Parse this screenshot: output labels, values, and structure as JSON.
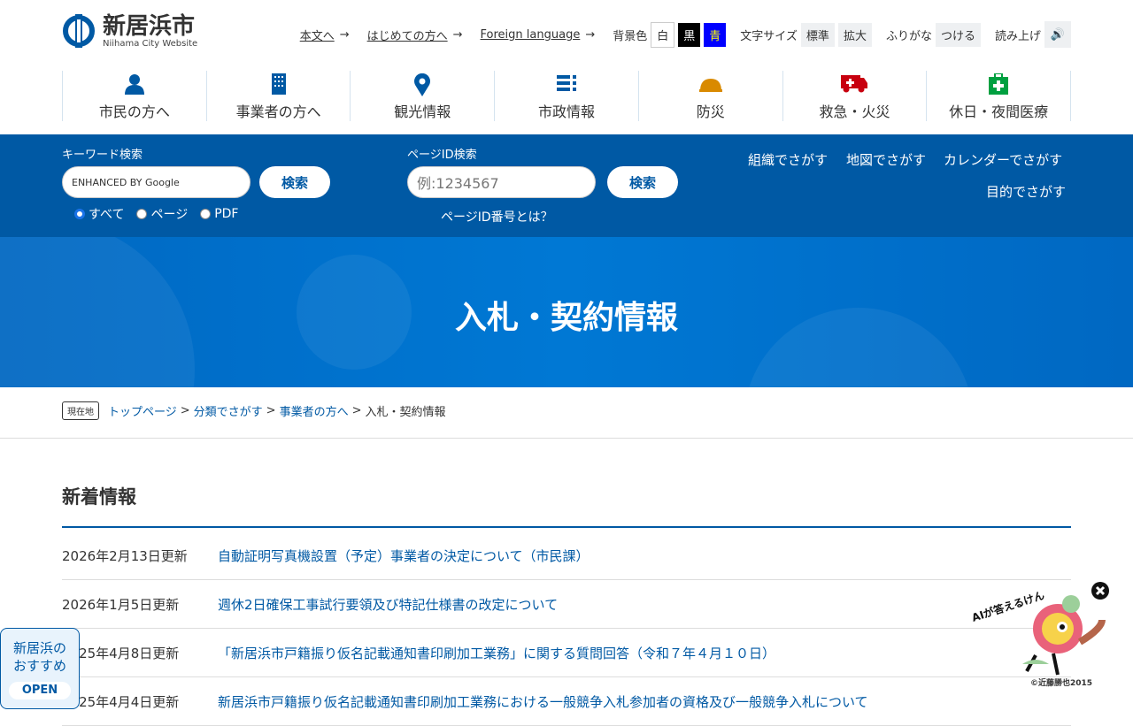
{
  "header": {
    "logo_title": "新居浜市",
    "logo_sub": "Niihama City Website",
    "links": [
      "本文へ",
      "はじめての方へ",
      "Foreign language"
    ],
    "bg_label": "背景色",
    "bg_options": [
      "白",
      "黒",
      "青"
    ],
    "size_label": "文字サイズ",
    "size_options": [
      "標準",
      "拡大"
    ],
    "furigana_label": "ふりがな",
    "furigana_btn": "つける",
    "read_label": "読み上げ"
  },
  "nav": [
    {
      "label": "市民の方へ",
      "icon": "person-icon"
    },
    {
      "label": "事業者の方へ",
      "icon": "building-icon"
    },
    {
      "label": "観光情報",
      "icon": "map-pin-icon"
    },
    {
      "label": "市政情報",
      "icon": "list-icon"
    },
    {
      "label": "防災",
      "icon": "helmet-icon"
    },
    {
      "label": "救急・火災",
      "icon": "ambulance-icon"
    },
    {
      "label": "休日・夜間医療",
      "icon": "first-aid-icon"
    }
  ],
  "search": {
    "keyword_label": "キーワード検索",
    "google_placeholder": "ENHANCED BY Google",
    "search_btn": "検索",
    "radios": [
      "すべて",
      "ページ",
      "PDF"
    ],
    "pageid_label": "ページID検索",
    "pageid_placeholder": "例:1234567",
    "pageid_btn": "検索",
    "pageid_help": "ページID番号とは？",
    "links": [
      "組織でさがす",
      "地図でさがす",
      "カレンダーでさがす",
      "目的でさがす"
    ]
  },
  "hero": {
    "title": "入札・契約情報"
  },
  "breadcrumb": {
    "here": "現在地",
    "items": [
      "トップページ",
      "分類でさがす",
      "事業者の方へ"
    ],
    "current": "入札・契約情報"
  },
  "news": {
    "title": "新着情報",
    "items": [
      {
        "date": "2026年2月13日更新",
        "title": "自動証明写真機設置（予定）事業者の決定について（市民課）"
      },
      {
        "date": "2026年1月5日更新",
        "title": "週休2日確保工事試行要領及び特記仕様書の改定について"
      },
      {
        "date": "2025年4月8日更新",
        "title": "「新居浜市戸籍振り仮名記載通知書印刷加工業務」に関する質問回答（令和７年４月１０日）"
      },
      {
        "date": "2025年4月4日更新",
        "title": "新居浜市戸籍振り仮名記載通知書印刷加工業務における一般競争入札参加者の資格及び一般競争入札について"
      }
    ]
  },
  "recommend": {
    "line1": "新居浜の",
    "line2": "おすすめ",
    "open": "OPEN"
  },
  "ai": {
    "label": "AIが答えるけん",
    "copyright": "©近藤勝也2015"
  }
}
